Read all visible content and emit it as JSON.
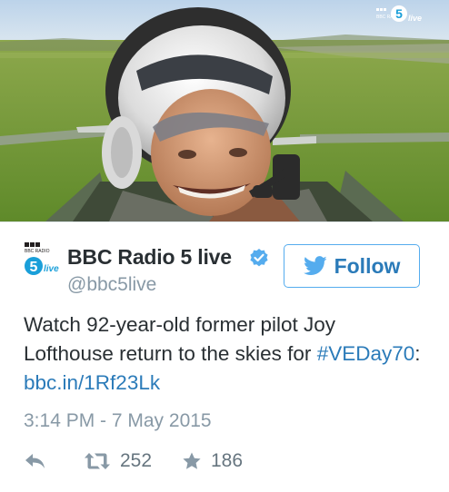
{
  "media": {
    "watermark_top": "BBC RADIO",
    "watermark_number": "5",
    "watermark_word": "live"
  },
  "account": {
    "name": "BBC Radio 5 live",
    "handle": "@bbc5live",
    "avatar_top": "BBC RADIO",
    "avatar_number": "5",
    "avatar_word": "live",
    "verified": true
  },
  "follow_button": {
    "label": "Follow",
    "icon": "twitter-bird-icon"
  },
  "tweet": {
    "text_before": "Watch 92-year-old former pilot Joy Lofthouse return to the skies for ",
    "hashtag": "#VEDay70",
    "separator": ": ",
    "link": "bbc.in/1Rf23Lk",
    "timestamp": "3:14 PM - 7 May 2015"
  },
  "actions": {
    "reply_icon": "reply-icon",
    "retweet_icon": "retweet-icon",
    "retweet_count": "252",
    "favorite_icon": "star-icon",
    "favorite_count": "186"
  },
  "colors": {
    "link": "#2b7bb9",
    "follow_border": "#55acee",
    "muted": "#8899a6",
    "text": "#292f33",
    "brand_blue": "#1a9fd9"
  }
}
